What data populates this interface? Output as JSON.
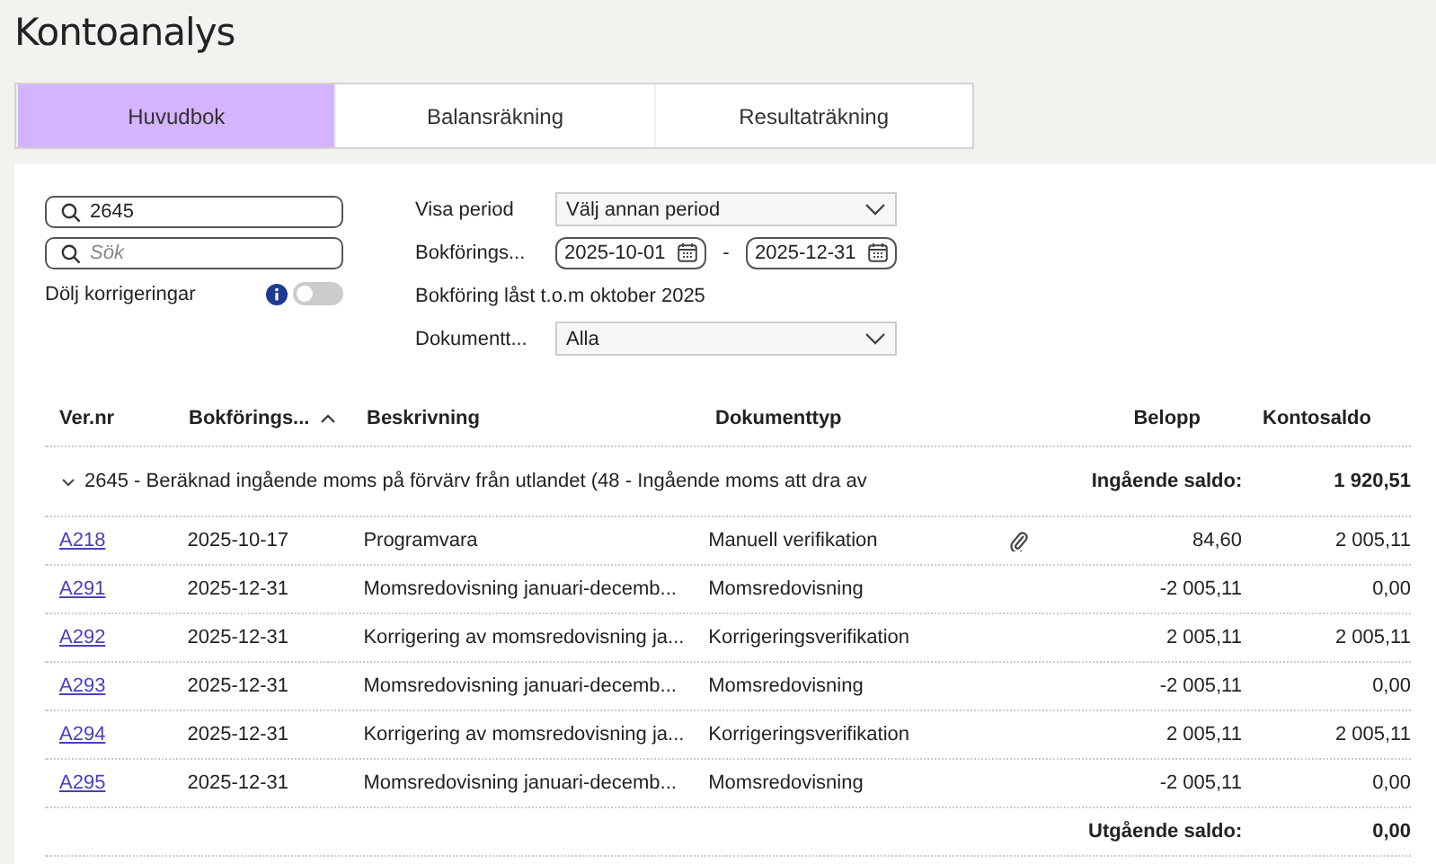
{
  "title": "Kontoanalys",
  "tabs": [
    {
      "label": "Huvudbok",
      "selected": true
    },
    {
      "label": "Balansräkning",
      "selected": false
    },
    {
      "label": "Resultaträkning",
      "selected": false
    }
  ],
  "filters": {
    "account_search": {
      "value": "2645"
    },
    "search": {
      "placeholder": "Sök"
    },
    "hide_corrections": {
      "label": "Dölj korrigeringar",
      "on": false
    },
    "period": {
      "label": "Visa period",
      "value": "Välj annan period"
    },
    "dates": {
      "label": "Bokförings...",
      "from": "2025-10-01",
      "separator": "-",
      "to": "2025-12-31"
    },
    "lock_notice": "Bokföring låst t.o.m oktober 2025",
    "doc_type": {
      "label": "Dokumentt...",
      "value": "Alla"
    }
  },
  "table": {
    "columns": [
      {
        "label": "Ver.nr",
        "sorted": false
      },
      {
        "label": "Bokförings...",
        "sorted": true
      },
      {
        "label": "Beskrivning",
        "sorted": false
      },
      {
        "label": "Dokumenttyp",
        "sorted": false
      },
      {
        "label": "Belopp",
        "sorted": false
      },
      {
        "label": "Kontosaldo",
        "sorted": false
      }
    ],
    "group": {
      "label": "2645 - Beräknad ingående moms på förvärv från utlandet (48 - Ingående moms att dra av",
      "expanded": true,
      "opening_label": "Ingående saldo:",
      "opening_value": "1 920,51"
    },
    "rows": [
      {
        "ver": "A218",
        "date": "2025-10-17",
        "description": "Programvara",
        "doc_type": "Manuell verifikation",
        "attachment": true,
        "amount": "84,60",
        "balance": "2 005,11"
      },
      {
        "ver": "A291",
        "date": "2025-12-31",
        "description": "Momsredovisning januari-decemb...",
        "doc_type": "Momsredovisning",
        "attachment": false,
        "amount": "-2 005,11",
        "balance": "0,00"
      },
      {
        "ver": "A292",
        "date": "2025-12-31",
        "description": "Korrigering av momsredovisning ja...",
        "doc_type": "Korrigeringsverifikation",
        "attachment": false,
        "amount": "2 005,11",
        "balance": "2 005,11"
      },
      {
        "ver": "A293",
        "date": "2025-12-31",
        "description": "Momsredovisning januari-decemb...",
        "doc_type": "Momsredovisning",
        "attachment": false,
        "amount": "-2 005,11",
        "balance": "0,00"
      },
      {
        "ver": "A294",
        "date": "2025-12-31",
        "description": "Korrigering av momsredovisning ja...",
        "doc_type": "Korrigeringsverifikation",
        "attachment": false,
        "amount": "2 005,11",
        "balance": "2 005,11"
      },
      {
        "ver": "A295",
        "date": "2025-12-31",
        "description": "Momsredovisning januari-decemb...",
        "doc_type": "Momsredovisning",
        "attachment": false,
        "amount": "-2 005,11",
        "balance": "0,00"
      }
    ],
    "closing_label": "Utgående saldo:",
    "closing_value": "0,00"
  }
}
